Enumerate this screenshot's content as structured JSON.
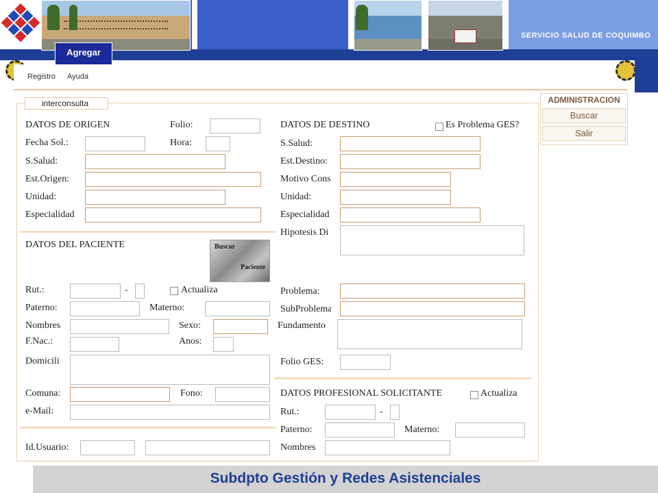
{
  "header": {
    "title": "SERVICIO SALUD DE COQUIMBO",
    "agregar_label": "Agregar"
  },
  "menu": {
    "items": [
      "Registro",
      "Ayuda"
    ]
  },
  "form": {
    "legend": "interconsulta",
    "origen": {
      "title": "DATOS DE ORIGEN",
      "folio_label": "Folio:",
      "fecha_label": "Fecha Sol.:",
      "hora_label": "Hora:",
      "salud_label": "S.Salud:",
      "est_label": "Est.Origen:",
      "unidad_label": "Unidad:",
      "especialidad_label": "Especialidad"
    },
    "destino": {
      "title": "DATOS DE DESTINO",
      "ges_label": "Es Problema GES?",
      "salud_label": "S.Salud:",
      "est_label": "Est.Destino:",
      "motivo_label": "Motivo Cons",
      "unidad_label": "Unidad:",
      "especialidad_label": "Especialidad",
      "hipotesis_label": "Hipotesis Di",
      "problema_label": "Problema:",
      "subproblema_label": "SubProblema",
      "fundamento_label": "Fundamento",
      "folio_ges_label": "Folio GES:"
    },
    "paciente": {
      "title": "DATOS DEL PACIENTE",
      "buscar_top": "Buscar",
      "buscar_bottom": "Paciente",
      "rut_label": "Rut.:",
      "dash": "-",
      "actualiza_label": "Actualiza",
      "paterno_label": "Paterno:",
      "materno_label": "Materno:",
      "nombres_label": "Nombres",
      "sexo_label": "Sexo:",
      "fnac_label": "F.Nac.:",
      "anos_label": "Anos:",
      "domicilio_label": "Domicili",
      "comuna_label": "Comuna:",
      "fono_label": "Fono:",
      "email_label": "e-Mail:",
      "usuario_label": "Id.Usuario:"
    },
    "profesional": {
      "title": "DATOS PROFESIONAL SOLICITANTE",
      "actualiza_label": "Actualiza",
      "rut_label": "Rut.:",
      "dash": "-",
      "paterno_label": "Paterno:",
      "materno_label": "Materno:",
      "nombres_label": "Nombres"
    }
  },
  "admin": {
    "title": "ADMINISTRACION",
    "buscar_label": "Buscar",
    "salir_label": "Salir"
  },
  "footer": {
    "text": "Subdpto Gestión y Redes Asistenciales"
  },
  "colors": {
    "banner_blue": "#3a5fc8",
    "dark_blue": "#1f3e95",
    "accent_border": "#c89a6a",
    "footer_gray": "#d3d3d3"
  }
}
